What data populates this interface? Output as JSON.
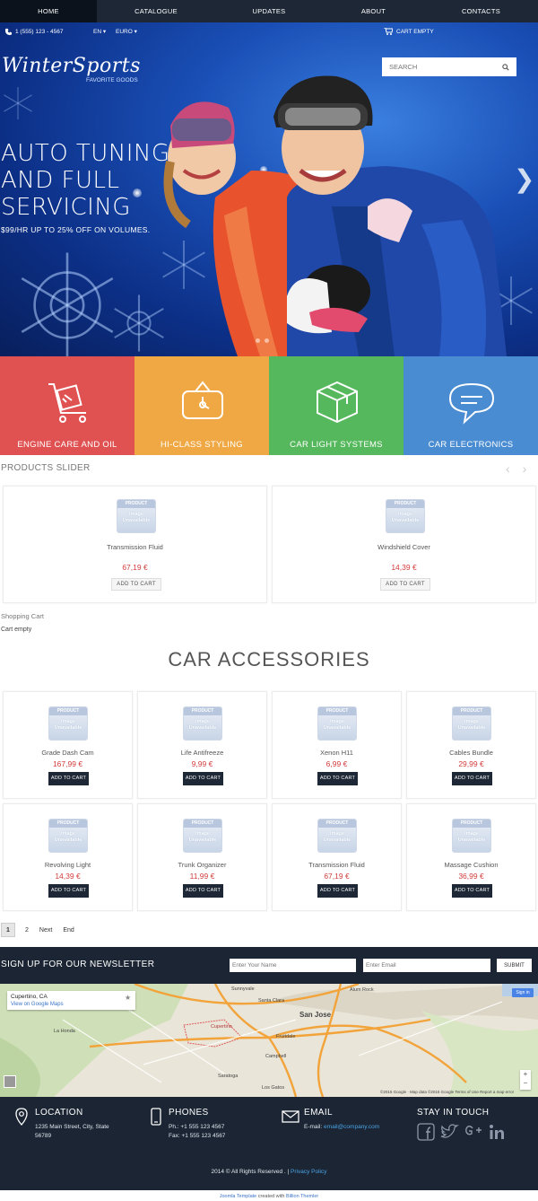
{
  "nav": {
    "items": [
      "HOME",
      "CATALOGUE",
      "UPDATES",
      "ABOUT",
      "CONTACTS"
    ]
  },
  "header": {
    "phone": "1 (555) 123 - 4567",
    "language": "EN",
    "currency": "EURO",
    "cart": "CART EMPTY",
    "logo": "WinterSports",
    "tagline": "FAVORITE GOODS",
    "search_placeholder": "SEARCH"
  },
  "hero": {
    "headline_lines": [
      "AUTO TUNING",
      "AND FULL",
      "SERVICING"
    ],
    "subline": "$99/HR UP TO 25% OFF ON VOLUMES."
  },
  "tiles": [
    {
      "label": "ENGINE CARE AND OIL",
      "color": "#e05252",
      "icon": "cart-box-icon"
    },
    {
      "label": "HI-CLASS STYLING",
      "color": "#f0a844",
      "icon": "clock-tag-icon"
    },
    {
      "label": "CAR LIGHT SYSTEMS",
      "color": "#55b85c",
      "icon": "box-icon"
    },
    {
      "label": "CAR ELECTRONICS",
      "color": "#4a8cd2",
      "icon": "chat-bubble-icon"
    }
  ],
  "products_slider": {
    "title": "PRODUCTS SLIDER",
    "items": [
      {
        "name": "Transmission Fluid",
        "price": "67,19 €",
        "button": "ADD TO CART"
      },
      {
        "name": "Windshield Cover",
        "price": "14,39 €",
        "button": "ADD TO CART"
      }
    ]
  },
  "placeholder": {
    "top": "PRODUCT",
    "line1": "Image",
    "line2": "Unavailable"
  },
  "shopping_cart": {
    "title": "Shopping Cart",
    "status": "Cart empty"
  },
  "accessories": {
    "title": "CAR ACCESSORIES",
    "button": "ADD TO CART",
    "items": [
      {
        "name": "Grade Dash Cam",
        "price": "167,99 €"
      },
      {
        "name": "Life Antifreeze",
        "price": "9,99 €"
      },
      {
        "name": "Xenon H11",
        "price": "6,99 €"
      },
      {
        "name": "Cables Bundle",
        "price": "29,99 €"
      },
      {
        "name": "Revolving Light",
        "price": "14,39 €"
      },
      {
        "name": "Trunk Organizer",
        "price": "11,99 €"
      },
      {
        "name": "Transmission Fluid",
        "price": "67,19 €"
      },
      {
        "name": "Massage Cushion",
        "price": "36,99 €"
      }
    ]
  },
  "pagination": [
    "1",
    "2",
    "Next",
    "End"
  ],
  "newsletter": {
    "title": "SIGN UP FOR OUR NEWSLETTER",
    "name_placeholder": "Enter Your Name",
    "email_placeholder": "Enter Email",
    "button": "SUBMIT"
  },
  "map": {
    "location": "Cupertino, CA",
    "link": "View on Google Maps",
    "sign_in": "Sign in",
    "labels": [
      "Sunnyvale",
      "Santa Clara",
      "San Jose",
      "Cupertino",
      "Campbell",
      "Saratoga",
      "Los Gatos",
      "La Honda",
      "Fruitdale",
      "Alum Rock"
    ],
    "footer": "©2015 Google · Map data ©2015 Google   Terms of Use   Report a map error"
  },
  "footer": {
    "location": {
      "title": "LOCATION",
      "line1": "1235 Main Street, City, State",
      "line2": "56789"
    },
    "phones": {
      "title": "PHONES",
      "line1": "Ph.: +1 555 123 4567",
      "line2": "Fax: +1 555 123 4567"
    },
    "email": {
      "title": "EMAIL",
      "label": "E-mail:",
      "address": "email@company.com"
    },
    "social": {
      "title": "STAY IN TOUCH",
      "icons": [
        "facebook-icon",
        "twitter-icon",
        "google-plus-icon",
        "linkedin-icon"
      ]
    },
    "copyright": "2014 © All Rights Reserved . |",
    "privacy": "Privacy Policy"
  },
  "credits": {
    "text1": "Joomla Template",
    "text2": "created with",
    "text3": "Billion Themler"
  }
}
